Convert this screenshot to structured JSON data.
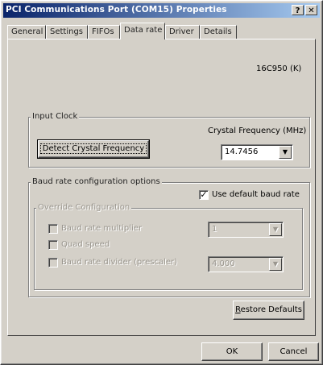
{
  "window": {
    "title": "PCI Communications Port (COM15) Properties",
    "help_label": "?",
    "close_label": "✕"
  },
  "tabs": [
    {
      "label": "General",
      "active": false
    },
    {
      "label": "Settings",
      "active": false
    },
    {
      "label": "FIFOs",
      "active": false
    },
    {
      "label": "Data rate",
      "active": true
    },
    {
      "label": "Driver",
      "active": false
    },
    {
      "label": "Details",
      "active": false
    }
  ],
  "device": {
    "chip_label": "16C950 (K)"
  },
  "input_clock": {
    "group_label": "Input Clock",
    "crystal_label": "Crystal Frequency (MHz)",
    "crystal_value": "14.7456",
    "detect_button": "Detect Crystal Frequency"
  },
  "baud": {
    "group_label": "Baud rate configuration options",
    "use_default_label": "Use default baud rate",
    "use_default_checked": true,
    "override": {
      "group_label": "Override Configuration",
      "multiplier_label": "Baud rate multiplier",
      "multiplier_value": "1",
      "quad_label": "Quad speed",
      "divider_label": "Baud rate divider (prescaler)",
      "divider_value": "4.000"
    }
  },
  "buttons": {
    "restore_pre": "",
    "restore_accel": "R",
    "restore_post": "estore Defaults",
    "ok": "OK",
    "cancel": "Cancel"
  }
}
